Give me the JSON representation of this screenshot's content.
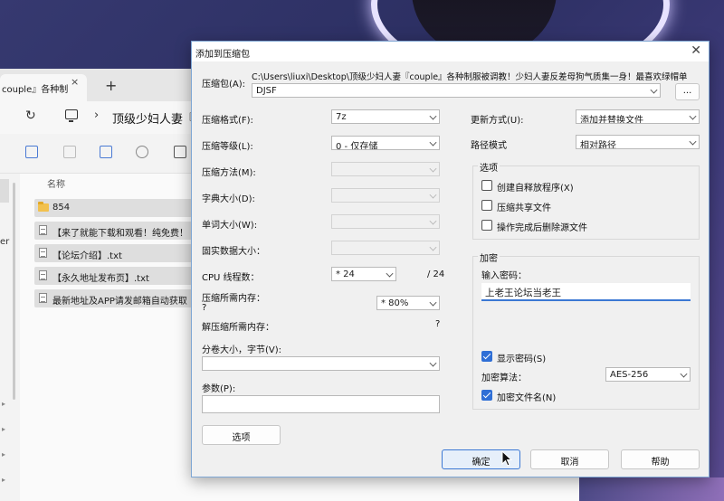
{
  "explorer": {
    "tab_label": "couple』各种制",
    "tab_close": "×",
    "new_tab": "+",
    "path": "顶级少妇人妻『c",
    "nav_partial": "er",
    "column_name": "名称",
    "files": [
      {
        "name": "854",
        "type": "folder"
      },
      {
        "name": "【来了就能下载和观看！纯免费！",
        "type": "txt"
      },
      {
        "name": "【论坛介绍】.txt",
        "type": "txt"
      },
      {
        "name": "【永久地址发布页】.txt",
        "type": "txt"
      },
      {
        "name": "最新地址及APP请发邮箱自动获取",
        "type": "txt"
      }
    ]
  },
  "dialog": {
    "title": "添加到压缩包",
    "close": "✕",
    "archive_label": "压缩包(A):",
    "archive_path": "C:\\Users\\liuxi\\Desktop\\顶级少妇人妻『couple』各种制服被调教！少妇人妻反差母狗气质集一身！最喜欢绿帽单",
    "archive_name": "DJSF",
    "browse": "...",
    "format_label": "压缩格式(F):",
    "format_value": "7z",
    "level_label": "压缩等级(L):",
    "level_value": "0 - 仅存储",
    "method_label": "压缩方法(M):",
    "dict_label": "字典大小(D):",
    "word_label": "单词大小(W):",
    "solid_label": "固实数据大小：",
    "cpu_label": "CPU 线程数：",
    "cpu_value": "* 24",
    "cpu_total": "/ 24",
    "mem_compress_label": "压缩所需内存：",
    "mem_compress_q": "?",
    "mem_value": "* 80%",
    "mem_decompress_label": "解压缩所需内存：",
    "mem_decompress_q": "?",
    "split_label": "分卷大小，字节(V):",
    "params_label": "参数(P):",
    "options_button": "选项",
    "update_label": "更新方式(U):",
    "update_value": "添加并替换文件",
    "pathmode_label": "路径模式",
    "pathmode_value": "相对路径",
    "options_group": "选项",
    "opt_sfx": "创建自释放程序(X)",
    "opt_shared": "压缩共享文件",
    "opt_delete": "操作完成后删除源文件",
    "encrypt_group": "加密",
    "password_label": "输入密码：",
    "password_value": "上老王论坛当老王",
    "show_password": "显示密码(S)",
    "enc_method_label": "加密算法：",
    "enc_method_value": "AES-256",
    "encrypt_names": "加密文件名(N)",
    "ok": "确定",
    "cancel": "取消",
    "help": "帮助"
  },
  "colors": {
    "accent": "#3b78d4",
    "checkbox_checked": "#2f6fd6"
  }
}
